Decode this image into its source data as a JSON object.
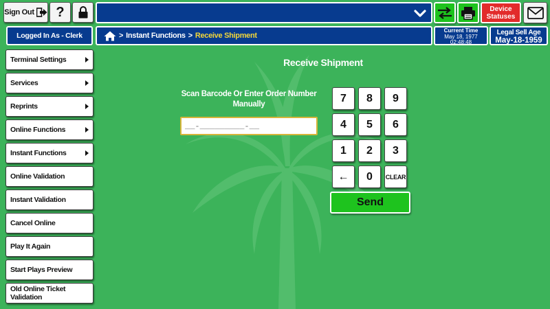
{
  "header": {
    "sign_out_label": "Sign Out",
    "help_label": "?",
    "device_statuses_line1": "Device",
    "device_statuses_line2": "Statuses",
    "logged_in_label": "Logged In As - Clerk",
    "breadcrumb": {
      "item1": "Instant Functions",
      "current": "Receive Shipment",
      "separator": ">"
    },
    "current_time": {
      "label": "Current Time",
      "date": "May 18, 1977",
      "time": "02:48:48"
    },
    "legal_sell_age": {
      "label": "Legal Sell Age",
      "date": "May-18-1959"
    }
  },
  "sidebar": {
    "items": [
      {
        "label": "Terminal Settings",
        "arrow": true
      },
      {
        "label": "Services",
        "arrow": true
      },
      {
        "label": "Reprints",
        "arrow": true
      },
      {
        "label": "Online Functions",
        "arrow": true
      },
      {
        "label": "Instant Functions",
        "arrow": true
      },
      {
        "label": "Online Validation",
        "arrow": false
      },
      {
        "label": "Instant Validation",
        "arrow": false
      },
      {
        "label": "Cancel Online",
        "arrow": false
      },
      {
        "label": "Play It Again",
        "arrow": false
      },
      {
        "label": "Start Plays Preview",
        "arrow": false
      },
      {
        "label": "Old Online Ticket Validation",
        "arrow": false
      }
    ]
  },
  "main": {
    "title": "Receive Shipment",
    "scan_label": "Scan Barcode Or Enter Order Number Manually",
    "barcode_placeholder": "__-_________-__",
    "keypad": {
      "keys": [
        "7",
        "8",
        "9",
        "4",
        "5",
        "6",
        "1",
        "2",
        "3",
        "←",
        "0",
        "CLEAR"
      ]
    },
    "send_label": "Send"
  },
  "colors": {
    "background": "#3cb35a",
    "header_blue": "#073b8f",
    "accent_green": "#1ec31e",
    "alert_red": "#e22b2b",
    "breadcrumb_current": "#f2d63a"
  },
  "icons": {
    "sign_out": "exit-arrow-icon",
    "lock": "lock-icon",
    "dropdown": "chevron-down-icon",
    "transfer": "transfer-arrows-icon",
    "printer": "printer-icon",
    "mail": "envelope-icon",
    "home": "home-icon",
    "backspace": "backspace-arrow-icon"
  }
}
